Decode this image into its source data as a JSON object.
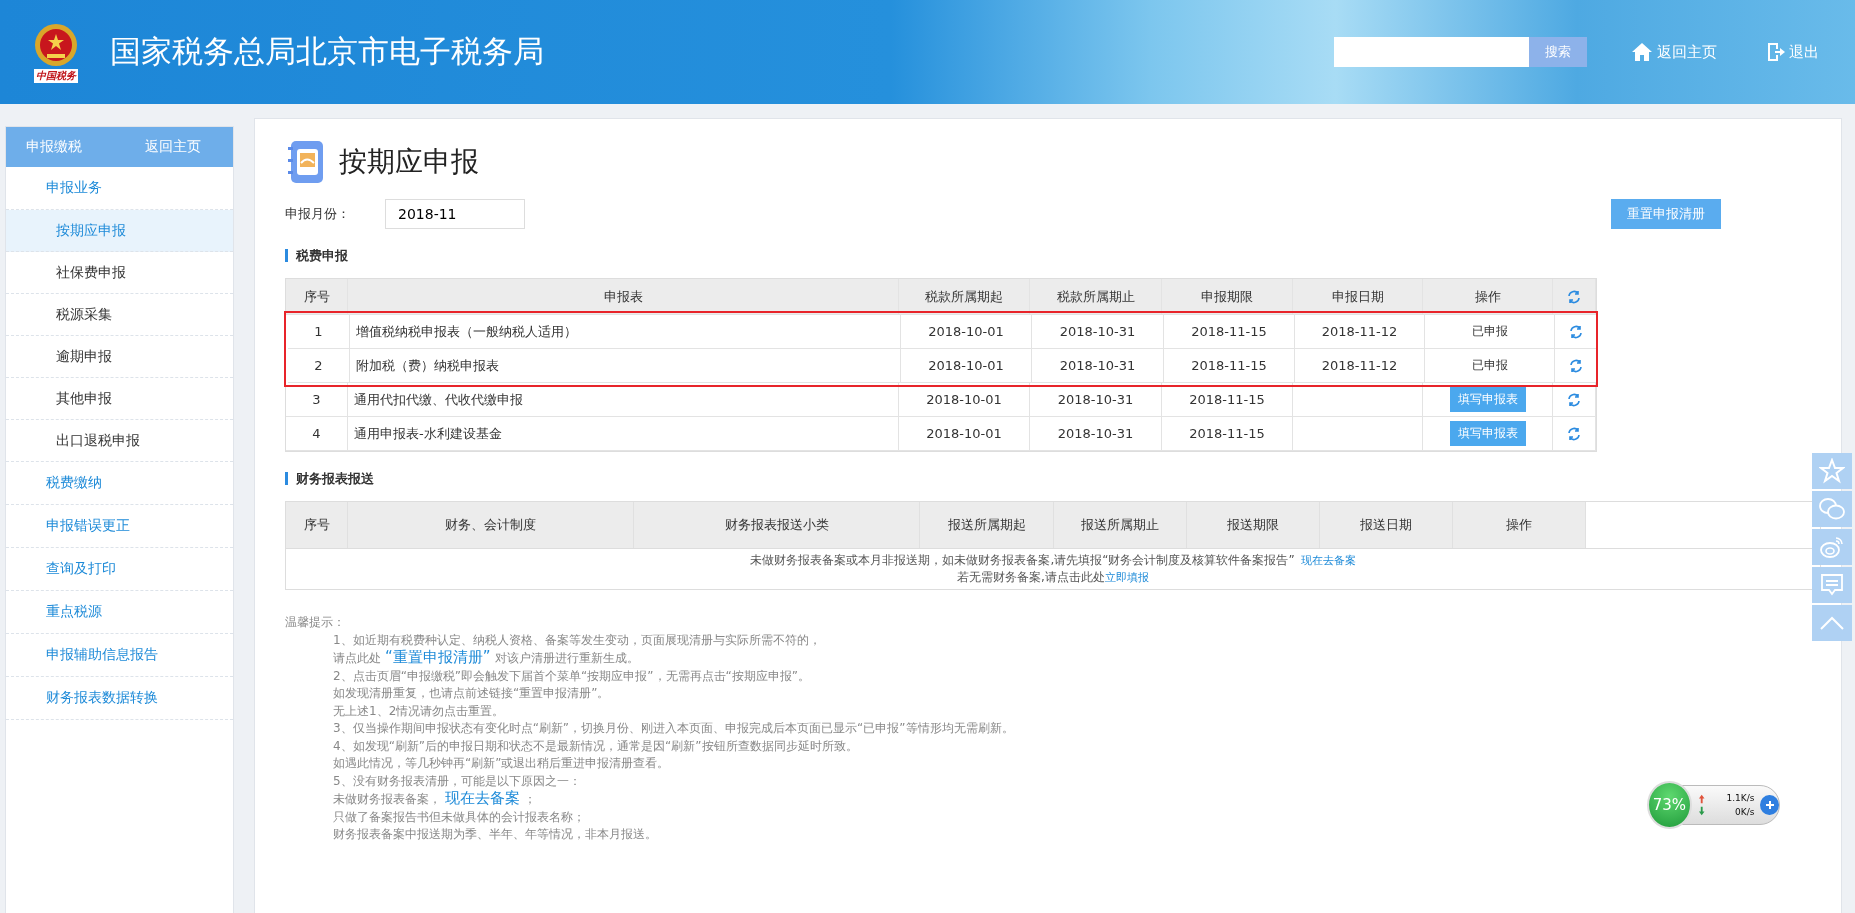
{
  "header": {
    "logo_caption": "中国税务",
    "title": "国家税务总局北京市电子税务局",
    "search": {
      "button": "搜索"
    },
    "links": [
      {
        "kind": "home",
        "label": "返回主页"
      },
      {
        "kind": "exit",
        "label": "退出"
      }
    ]
  },
  "sidebar": {
    "title": "申报缴税",
    "back_link": "返回主页",
    "items": [
      {
        "label": "申报业务",
        "selected": false,
        "children": [
          {
            "label": "按期应申报",
            "selected": true
          },
          {
            "label": "社保费申报",
            "selected": false
          },
          {
            "label": "税源采集",
            "selected": false
          },
          {
            "label": "逾期申报",
            "selected": false
          },
          {
            "label": "其他申报",
            "selected": false
          },
          {
            "label": "出口退税申报",
            "selected": false
          }
        ]
      },
      {
        "label": "税费缴纳",
        "selected": false
      },
      {
        "label": "申报错误更正",
        "selected": false
      },
      {
        "label": "查询及打印",
        "selected": false
      },
      {
        "label": "重点税源",
        "selected": false
      },
      {
        "label": "申报辅助信息报告",
        "selected": false
      },
      {
        "label": "财务报表数据转换",
        "selected": false
      }
    ]
  },
  "page": {
    "title": "按期应申报",
    "month_label": "申报月份：",
    "month_value": "2018-11",
    "reset_button": "重置申报清册"
  },
  "tax_section": {
    "title": "税费申报",
    "columns": [
      "序号",
      "申报表",
      "税款所属期起",
      "税款所属期止",
      "申报期限",
      "申报日期",
      "操作"
    ],
    "rows": [
      {
        "no": "1",
        "form": "增值税纳税申报表（一般纳税人适用）",
        "start": "2018-10-01",
        "end": "2018-10-31",
        "deadline": "2018-11-15",
        "filed": "2018-11-12",
        "action": {
          "kind": "status",
          "label": "已申报"
        },
        "highlighted": true
      },
      {
        "no": "2",
        "form": "附加税（费）纳税申报表",
        "start": "2018-10-01",
        "end": "2018-10-31",
        "deadline": "2018-11-15",
        "filed": "2018-11-12",
        "action": {
          "kind": "status",
          "label": "已申报"
        },
        "highlighted": true
      },
      {
        "no": "3",
        "form": "通用代扣代缴、代收代缴申报",
        "start": "2018-10-01",
        "end": "2018-10-31",
        "deadline": "2018-11-15",
        "action": {
          "kind": "button",
          "label": "填写申报表"
        },
        "highlighted": false
      },
      {
        "no": "4",
        "form": "通用申报表-水利建设基金",
        "start": "2018-10-01",
        "end": "2018-10-31",
        "deadline": "2018-11-15",
        "action": {
          "kind": "button",
          "label": "填写申报表"
        },
        "highlighted": false
      }
    ]
  },
  "finance_section": {
    "title": "财务报表报送",
    "columns": [
      "序号",
      "财务、会计制度",
      "财务报表报送小类",
      "报送所属期起",
      "报送所属期止",
      "报送期限",
      "报送日期",
      "操作"
    ],
    "empty_lines": [
      {
        "text": "未做财务报表备案或本月非报送期，如未做财务报表备案,请先填报“财务会计制度及核算软件备案报告”",
        "link": "现在去备案"
      },
      {
        "text": "若无需财务备案,请点击此处",
        "link": "立即填报"
      }
    ]
  },
  "tips": {
    "title": "温馨提示：",
    "lines": [
      {
        "text": "1、如近期有税费种认定、纳税人资格、备案等发生变动，页面展现清册与实际所需不符的，"
      },
      {
        "text": "请点此处",
        "link": "“重置申报清册”",
        "after": "对该户清册进行重新生成。"
      },
      {
        "text": "2、点击页眉“申报缴税”即会触发下届首个菜单“按期应申报”，无需再点击“按期应申报”。"
      },
      {
        "text": "如发现清册重复，也请点前述链接“重置申报清册”。"
      },
      {
        "text": "无上述1、2情况请勿点击重置。"
      },
      {
        "text": "3、仅当操作期间申报状态有变化时点“刷新”，切换月份、刚进入本页面、申报完成后本页面已显示“已申报”等情形均无需刷新。"
      },
      {
        "text": "4、如发现“刷新”后的申报日期和状态不是最新情况，通常是因“刷新”按钮所查数据同步延时所致。"
      },
      {
        "text": "如遇此情况，等几秒钟再“刷新”或退出稍后重进申报清册查看。"
      },
      {
        "text": "5、没有财务报表清册，可能是以下原因之一："
      },
      {
        "text": "未做财务报表备案，",
        "link": "现在去备案",
        "after": "；"
      },
      {
        "text": "只做了备案报告书但未做具体的会计报表名称；"
      },
      {
        "text": "财务报表备案中报送期为季、半年、年等情况，非本月报送。"
      }
    ]
  },
  "side_tools": [
    {
      "kind": "star"
    },
    {
      "kind": "chat"
    },
    {
      "kind": "weibo"
    },
    {
      "kind": "comment"
    },
    {
      "kind": "top"
    }
  ],
  "net_monitor": {
    "percent": "73%",
    "up": "1.1K/s",
    "down": "0K/s"
  }
}
